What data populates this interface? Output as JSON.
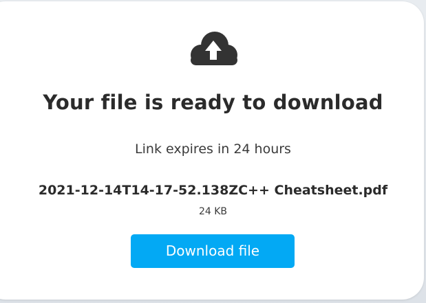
{
  "card": {
    "icon": "cloud-upload-icon",
    "title": "Your file is ready to download",
    "expiry": "Link expires in 24 hours",
    "file_name": "2021-12-14T14-17-52.138ZC++ Cheatsheet.pdf",
    "file_size": "24 KB",
    "download_label": "Download file"
  },
  "colors": {
    "accent": "#03a9f4",
    "icon": "#333333",
    "text": "#2b2b2b",
    "card_background": "#ffffff"
  }
}
